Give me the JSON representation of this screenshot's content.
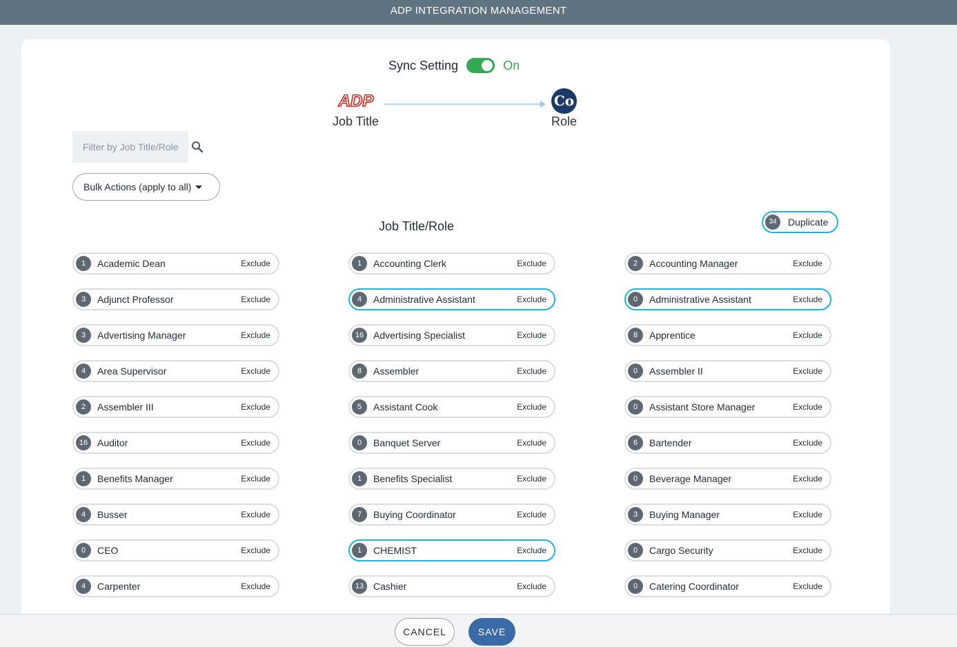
{
  "header": {
    "title": "ADP INTEGRATION MANAGEMENT"
  },
  "sync": {
    "label": "Sync Setting",
    "enabled": true,
    "state_label": "On",
    "toggle_color": "#34a853"
  },
  "mapping": {
    "source_logo": "ADP",
    "source_label": "Job Title",
    "target_logo": "Co",
    "target_label": "Role"
  },
  "filter": {
    "placeholder": "Filter by Job Title/Role",
    "value": ""
  },
  "bulk_actions": {
    "label": "Bulk Actions (apply to all)"
  },
  "section": {
    "title": "Job Title/Role"
  },
  "duplicate": {
    "count": "34",
    "label": "Duplicate",
    "highlight_color": "#1ab4dd"
  },
  "exclude_label": "Exclude",
  "columns": [
    [
      {
        "count": "1",
        "title": "Academic Dean",
        "duplicate": false
      },
      {
        "count": "3",
        "title": "Adjunct Professor",
        "duplicate": false
      },
      {
        "count": "3",
        "title": "Advertising Manager",
        "duplicate": false
      },
      {
        "count": "4",
        "title": "Area Supervisor",
        "duplicate": false
      },
      {
        "count": "2",
        "title": "Assembler III",
        "duplicate": false
      },
      {
        "count": "16",
        "title": "Auditor",
        "duplicate": false
      },
      {
        "count": "1",
        "title": "Benefits Manager",
        "duplicate": false
      },
      {
        "count": "4",
        "title": "Busser",
        "duplicate": false
      },
      {
        "count": "0",
        "title": "CEO",
        "duplicate": false
      },
      {
        "count": "4",
        "title": "Carpenter",
        "duplicate": false
      }
    ],
    [
      {
        "count": "1",
        "title": "Accounting Clerk",
        "duplicate": false
      },
      {
        "count": "4",
        "title": "Administrative Assistant",
        "duplicate": true
      },
      {
        "count": "16",
        "title": "Advertising Specialist",
        "duplicate": false
      },
      {
        "count": "8",
        "title": "Assembler",
        "duplicate": false
      },
      {
        "count": "5",
        "title": "Assistant Cook",
        "duplicate": false
      },
      {
        "count": "0",
        "title": "Banquet Server",
        "duplicate": false
      },
      {
        "count": "1",
        "title": "Benefits Specialist",
        "duplicate": false
      },
      {
        "count": "7",
        "title": "Buying Coordinator",
        "duplicate": false
      },
      {
        "count": "1",
        "title": "CHEMIST",
        "duplicate": true
      },
      {
        "count": "13",
        "title": "Cashier",
        "duplicate": false
      }
    ],
    [
      {
        "count": "2",
        "title": "Accounting Manager",
        "duplicate": false
      },
      {
        "count": "0",
        "title": "Administrative Assistant",
        "duplicate": true
      },
      {
        "count": "8",
        "title": "Apprentice",
        "duplicate": false
      },
      {
        "count": "0",
        "title": "Assembler II",
        "duplicate": false
      },
      {
        "count": "0",
        "title": "Assistant Store Manager",
        "duplicate": false
      },
      {
        "count": "6",
        "title": "Bartender",
        "duplicate": false
      },
      {
        "count": "0",
        "title": "Beverage Manager",
        "duplicate": false
      },
      {
        "count": "3",
        "title": "Buying Manager",
        "duplicate": false
      },
      {
        "count": "0",
        "title": "Cargo Security",
        "duplicate": false
      },
      {
        "count": "0",
        "title": "Catering Coordinator",
        "duplicate": false
      }
    ]
  ],
  "footer": {
    "cancel_label": "CANCEL",
    "save_label": "SAVE",
    "save_color": "#3a6aa8"
  }
}
